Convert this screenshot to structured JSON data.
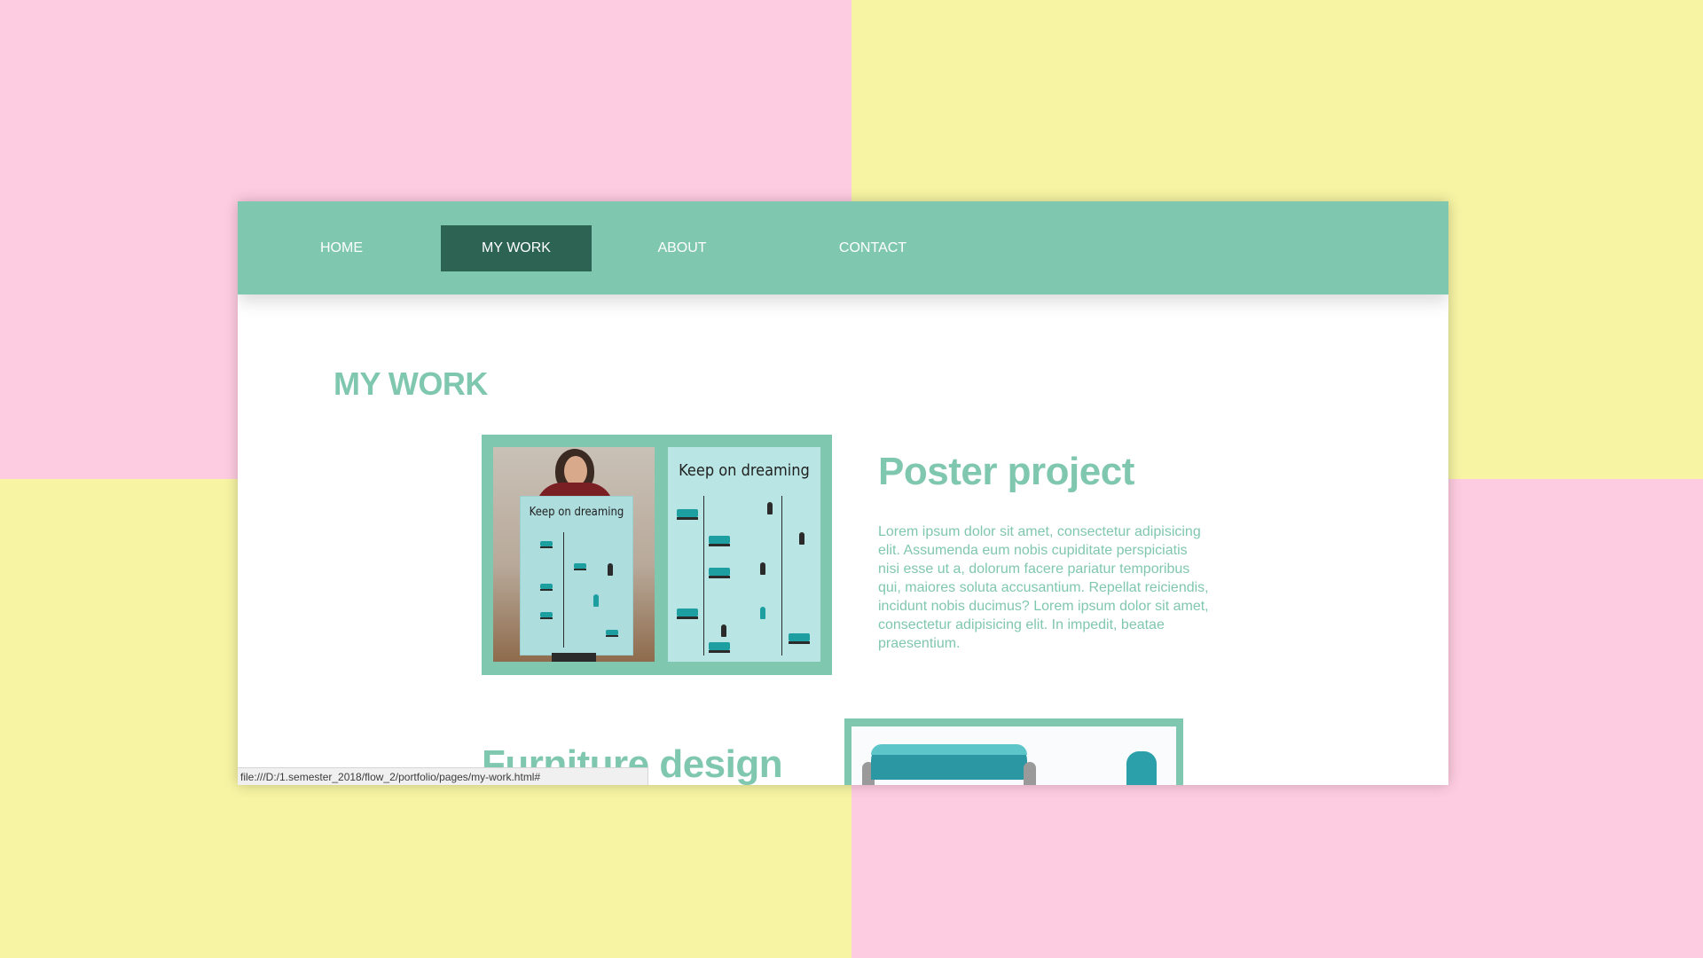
{
  "colors": {
    "background_pink": "#fecce0",
    "background_yellow": "#f7f4a3",
    "navbar": "#80c7af",
    "nav_active": "#2d6352",
    "accent_text": "#80c7af"
  },
  "nav": {
    "items": [
      {
        "label": "HOME",
        "active": false
      },
      {
        "label": "MY WORK",
        "active": true
      },
      {
        "label": "ABOUT",
        "active": false
      },
      {
        "label": "CONTACT",
        "active": false
      }
    ]
  },
  "main": {
    "heading": "MY WORK",
    "projects": [
      {
        "title": "Poster project",
        "image_text": "Keep on dreaming",
        "description": "Lorem ipsum dolor sit amet, consectetur adipisicing elit. Assumenda eum nobis cupiditate perspiciatis nisi esse ut a, dolorum facere pariatur temporibus qui, maiores soluta accusantium. Repellat reiciendis, incidunt nobis ducimus? Lorem ipsum dolor sit amet, consectetur adipisicing elit. In impedit, beatae praesentium."
      },
      {
        "title": "Furniture design"
      }
    ]
  },
  "status_bar": {
    "url": "file:///D:/1.semester_2018/flow_2/portfolio/pages/my-work.html#"
  }
}
